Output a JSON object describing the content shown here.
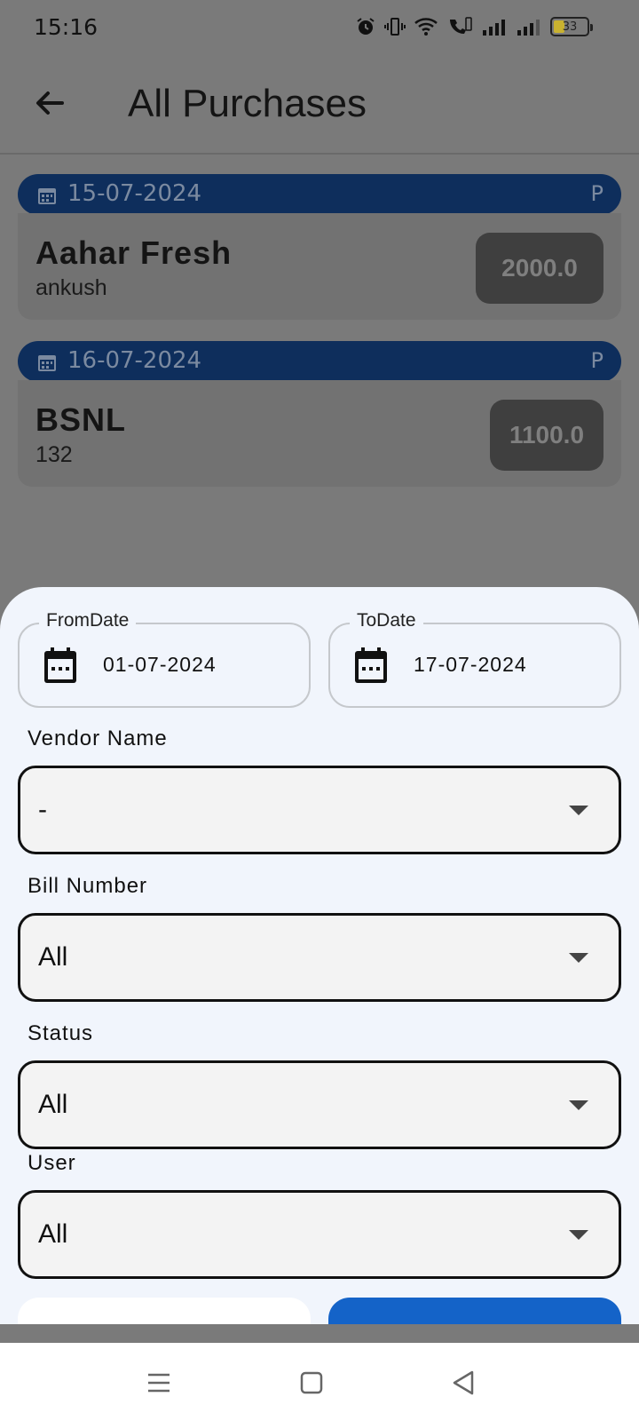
{
  "status_bar": {
    "time": "15:16",
    "battery": "33"
  },
  "app_bar": {
    "title": "All Purchases"
  },
  "purchases": [
    {
      "date": "15-07-2024",
      "status": "P",
      "vendor": "Aahar Fresh",
      "user": "ankush",
      "amount": "2000.0"
    },
    {
      "date": "16-07-2024",
      "status": "P",
      "vendor": "BSNL",
      "user": "132",
      "amount": "1100.0"
    }
  ],
  "filter": {
    "from_date": {
      "label": "FromDate",
      "value": "01-07-2024"
    },
    "to_date": {
      "label": "ToDate",
      "value": "17-07-2024"
    },
    "vendor_name": {
      "label": "Vendor Name",
      "value": "-"
    },
    "bill_number": {
      "label": "Bill Number",
      "value": "All"
    },
    "status": {
      "label": "Status",
      "value": "All"
    },
    "user": {
      "label": "User",
      "value": "All"
    }
  },
  "colors": {
    "scrim": "#7a7a7a",
    "date_pill": "#0e2e5c",
    "primary_button": "#1463c8",
    "sheet_bg": "#f1f5fc"
  }
}
